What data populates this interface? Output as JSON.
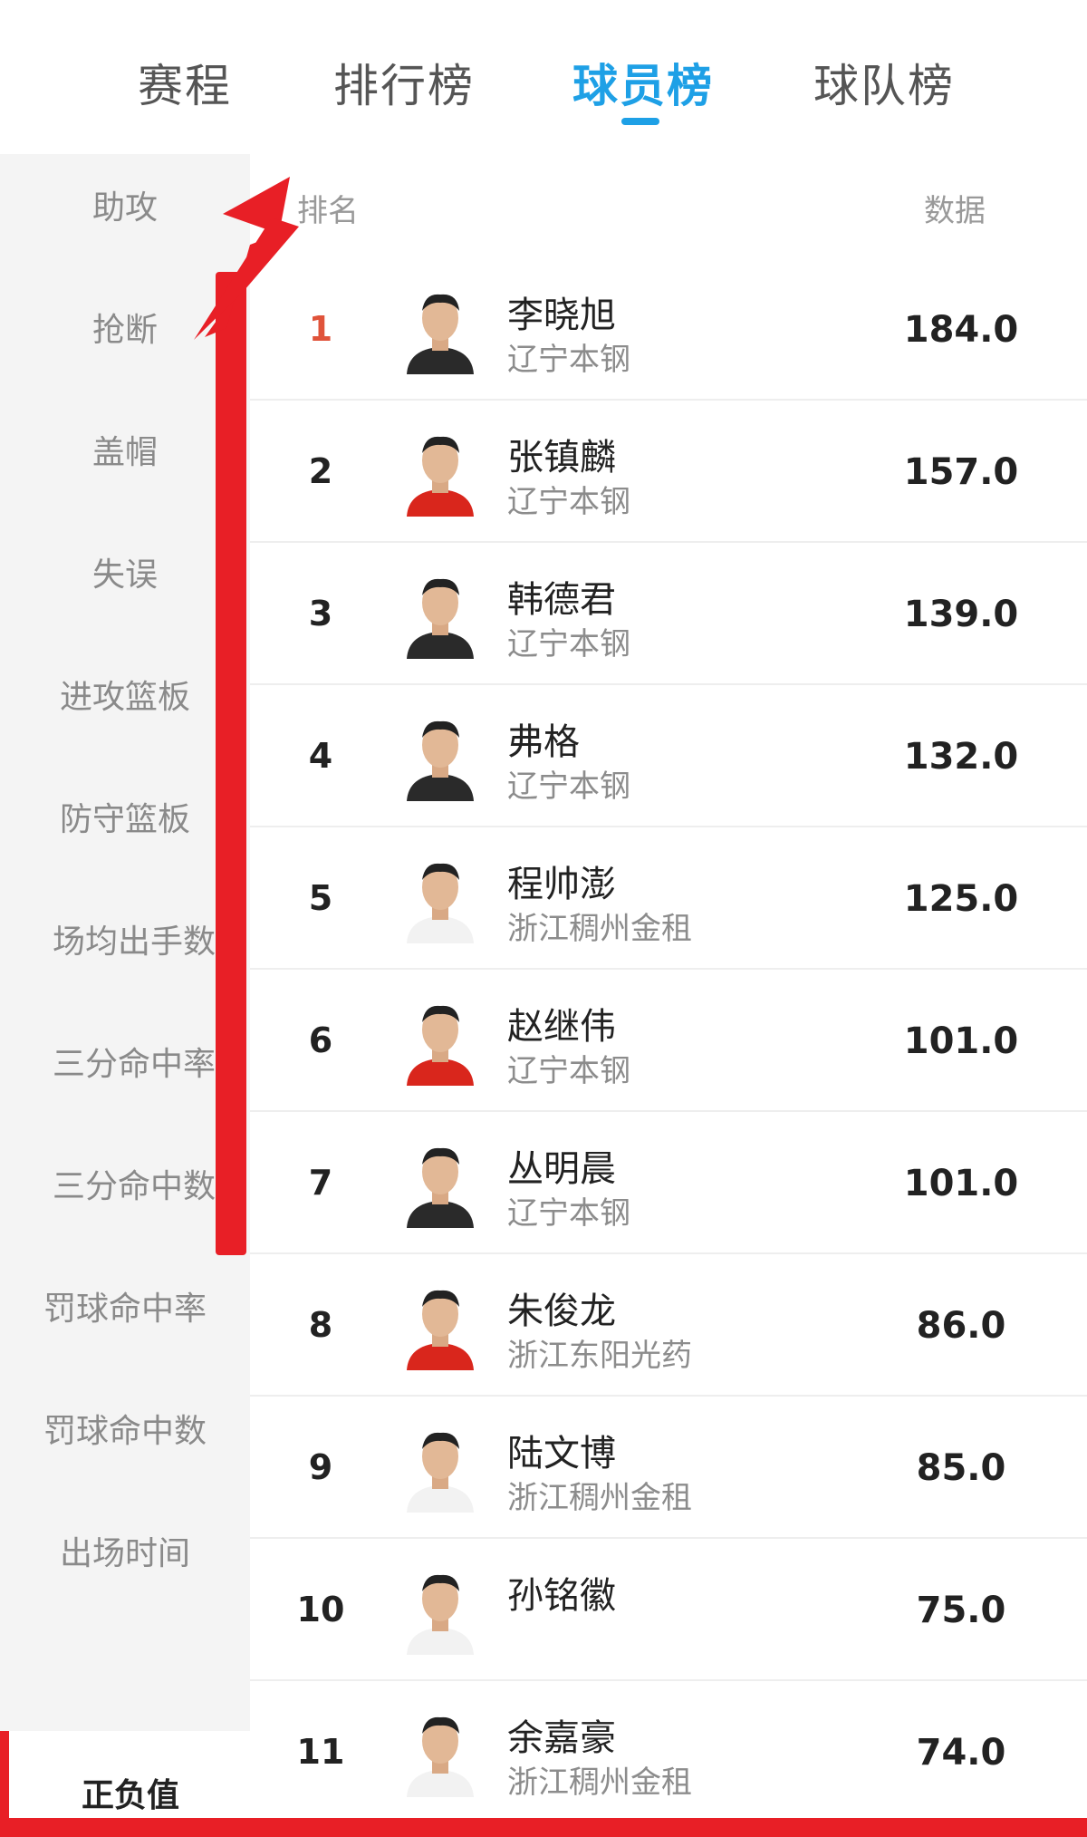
{
  "tabs": [
    {
      "label": "赛程"
    },
    {
      "label": "排行榜"
    },
    {
      "label": "球员榜"
    },
    {
      "label": "球队榜"
    }
  ],
  "active_tab": "球员榜",
  "sidebar": {
    "items": [
      {
        "label": "助攻"
      },
      {
        "label": "抢断"
      },
      {
        "label": "盖帽"
      },
      {
        "label": "失误"
      },
      {
        "label": "进攻篮板"
      },
      {
        "label": "防守篮板"
      },
      {
        "label": "场均出手数"
      },
      {
        "label": "三分命中率"
      },
      {
        "label": "三分命中数"
      },
      {
        "label": "罚球命中率"
      },
      {
        "label": "罚球命中数"
      },
      {
        "label": "出场时间"
      }
    ],
    "selected_label": "正负值"
  },
  "table": {
    "rank_header": "排名",
    "value_header": "数据",
    "rows": [
      {
        "rank": "1",
        "name": "李晓旭",
        "team": "辽宁本钢",
        "value": "184.0",
        "jersey": "dark"
      },
      {
        "rank": "2",
        "name": "张镇麟",
        "team": "辽宁本钢",
        "value": "157.0",
        "jersey": "china"
      },
      {
        "rank": "3",
        "name": "韩德君",
        "team": "辽宁本钢",
        "value": "139.0",
        "jersey": "dark"
      },
      {
        "rank": "4",
        "name": "弗格",
        "team": "辽宁本钢",
        "value": "132.0",
        "jersey": "dark"
      },
      {
        "rank": "5",
        "name": "程帅澎",
        "team": "浙江稠州金租",
        "value": "125.0",
        "jersey": "white"
      },
      {
        "rank": "6",
        "name": "赵继伟",
        "team": "辽宁本钢",
        "value": "101.0",
        "jersey": "china"
      },
      {
        "rank": "7",
        "name": "丛明晨",
        "team": "辽宁本钢",
        "value": "101.0",
        "jersey": "dark"
      },
      {
        "rank": "8",
        "name": "朱俊龙",
        "team": "浙江东阳光药",
        "value": "86.0",
        "jersey": "china"
      },
      {
        "rank": "9",
        "name": "陆文博",
        "team": "浙江稠州金租",
        "value": "85.0",
        "jersey": "white"
      },
      {
        "rank": "10",
        "name": "孙铭徽",
        "team": "",
        "value": "75.0",
        "jersey": "white"
      },
      {
        "rank": "11",
        "name": "余嘉豪",
        "team": "浙江稠州金租",
        "value": "74.0",
        "jersey": "white"
      }
    ]
  },
  "colors": {
    "accent": "#1ea0e6",
    "rank_first": "#e0533a",
    "annotation_red": "#e81f26",
    "china_jersey": "#d9261c"
  },
  "icons": {
    "avatar": "player-avatar-icon",
    "annotation": "up-arrow-icon"
  }
}
